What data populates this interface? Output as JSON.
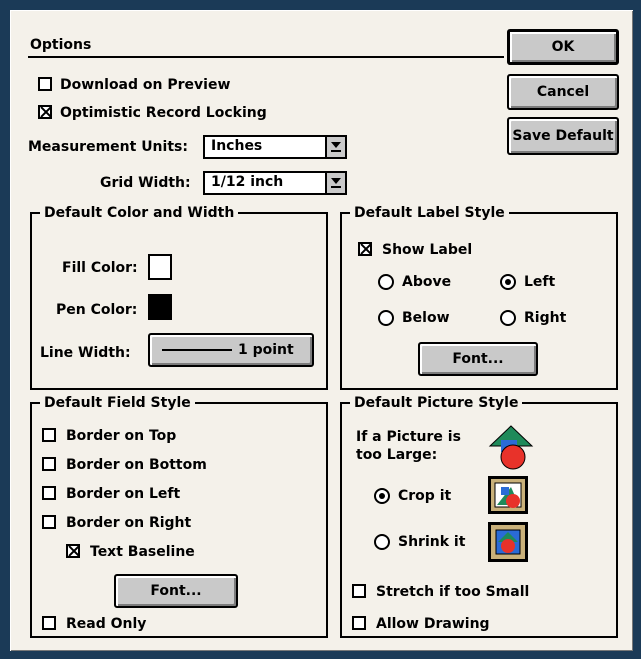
{
  "dialog": {
    "title": "Options",
    "buttons": {
      "ok": "OK",
      "cancel": "Cancel",
      "save_default": "Save Default"
    },
    "download_on_preview": {
      "label": "Download on Preview",
      "checked": false
    },
    "optimistic_record_locking": {
      "label": "Optimistic Record Locking",
      "checked": true
    },
    "measurement_units": {
      "label": "Measurement Units:",
      "value": "Inches"
    },
    "grid_width": {
      "label": "Grid Width:",
      "value": "1/12 inch"
    }
  },
  "color_width": {
    "title": "Default Color and Width",
    "fill_color_label": "Fill Color:",
    "fill_color": "#ffffff",
    "pen_color_label": "Pen Color:",
    "pen_color": "#000000",
    "line_width_label": "Line Width:",
    "line_width_value": "1 point"
  },
  "label_style": {
    "title": "Default Label Style",
    "show_label": {
      "label": "Show Label",
      "checked": true
    },
    "positions": [
      "Above",
      "Left",
      "Below",
      "Right"
    ],
    "selected": "Left",
    "font_button": "Font..."
  },
  "field_style": {
    "title": "Default Field Style",
    "border_top": "Border on Top",
    "border_bottom": "Border on Bottom",
    "border_left": "Border on Left",
    "border_right": "Border on Right",
    "text_baseline": {
      "label": "Text Baseline",
      "checked": true
    },
    "font_button": "Font...",
    "read_only": "Read Only"
  },
  "picture_style": {
    "title": "Default Picture Style",
    "prompt_line1": "If a Picture is",
    "prompt_line2": "too Large:",
    "crop_it": "Crop it",
    "shrink_it": "Shrink it",
    "selected": "Crop it",
    "stretch": "Stretch if too Small",
    "allow_drawing": "Allow Drawing"
  }
}
